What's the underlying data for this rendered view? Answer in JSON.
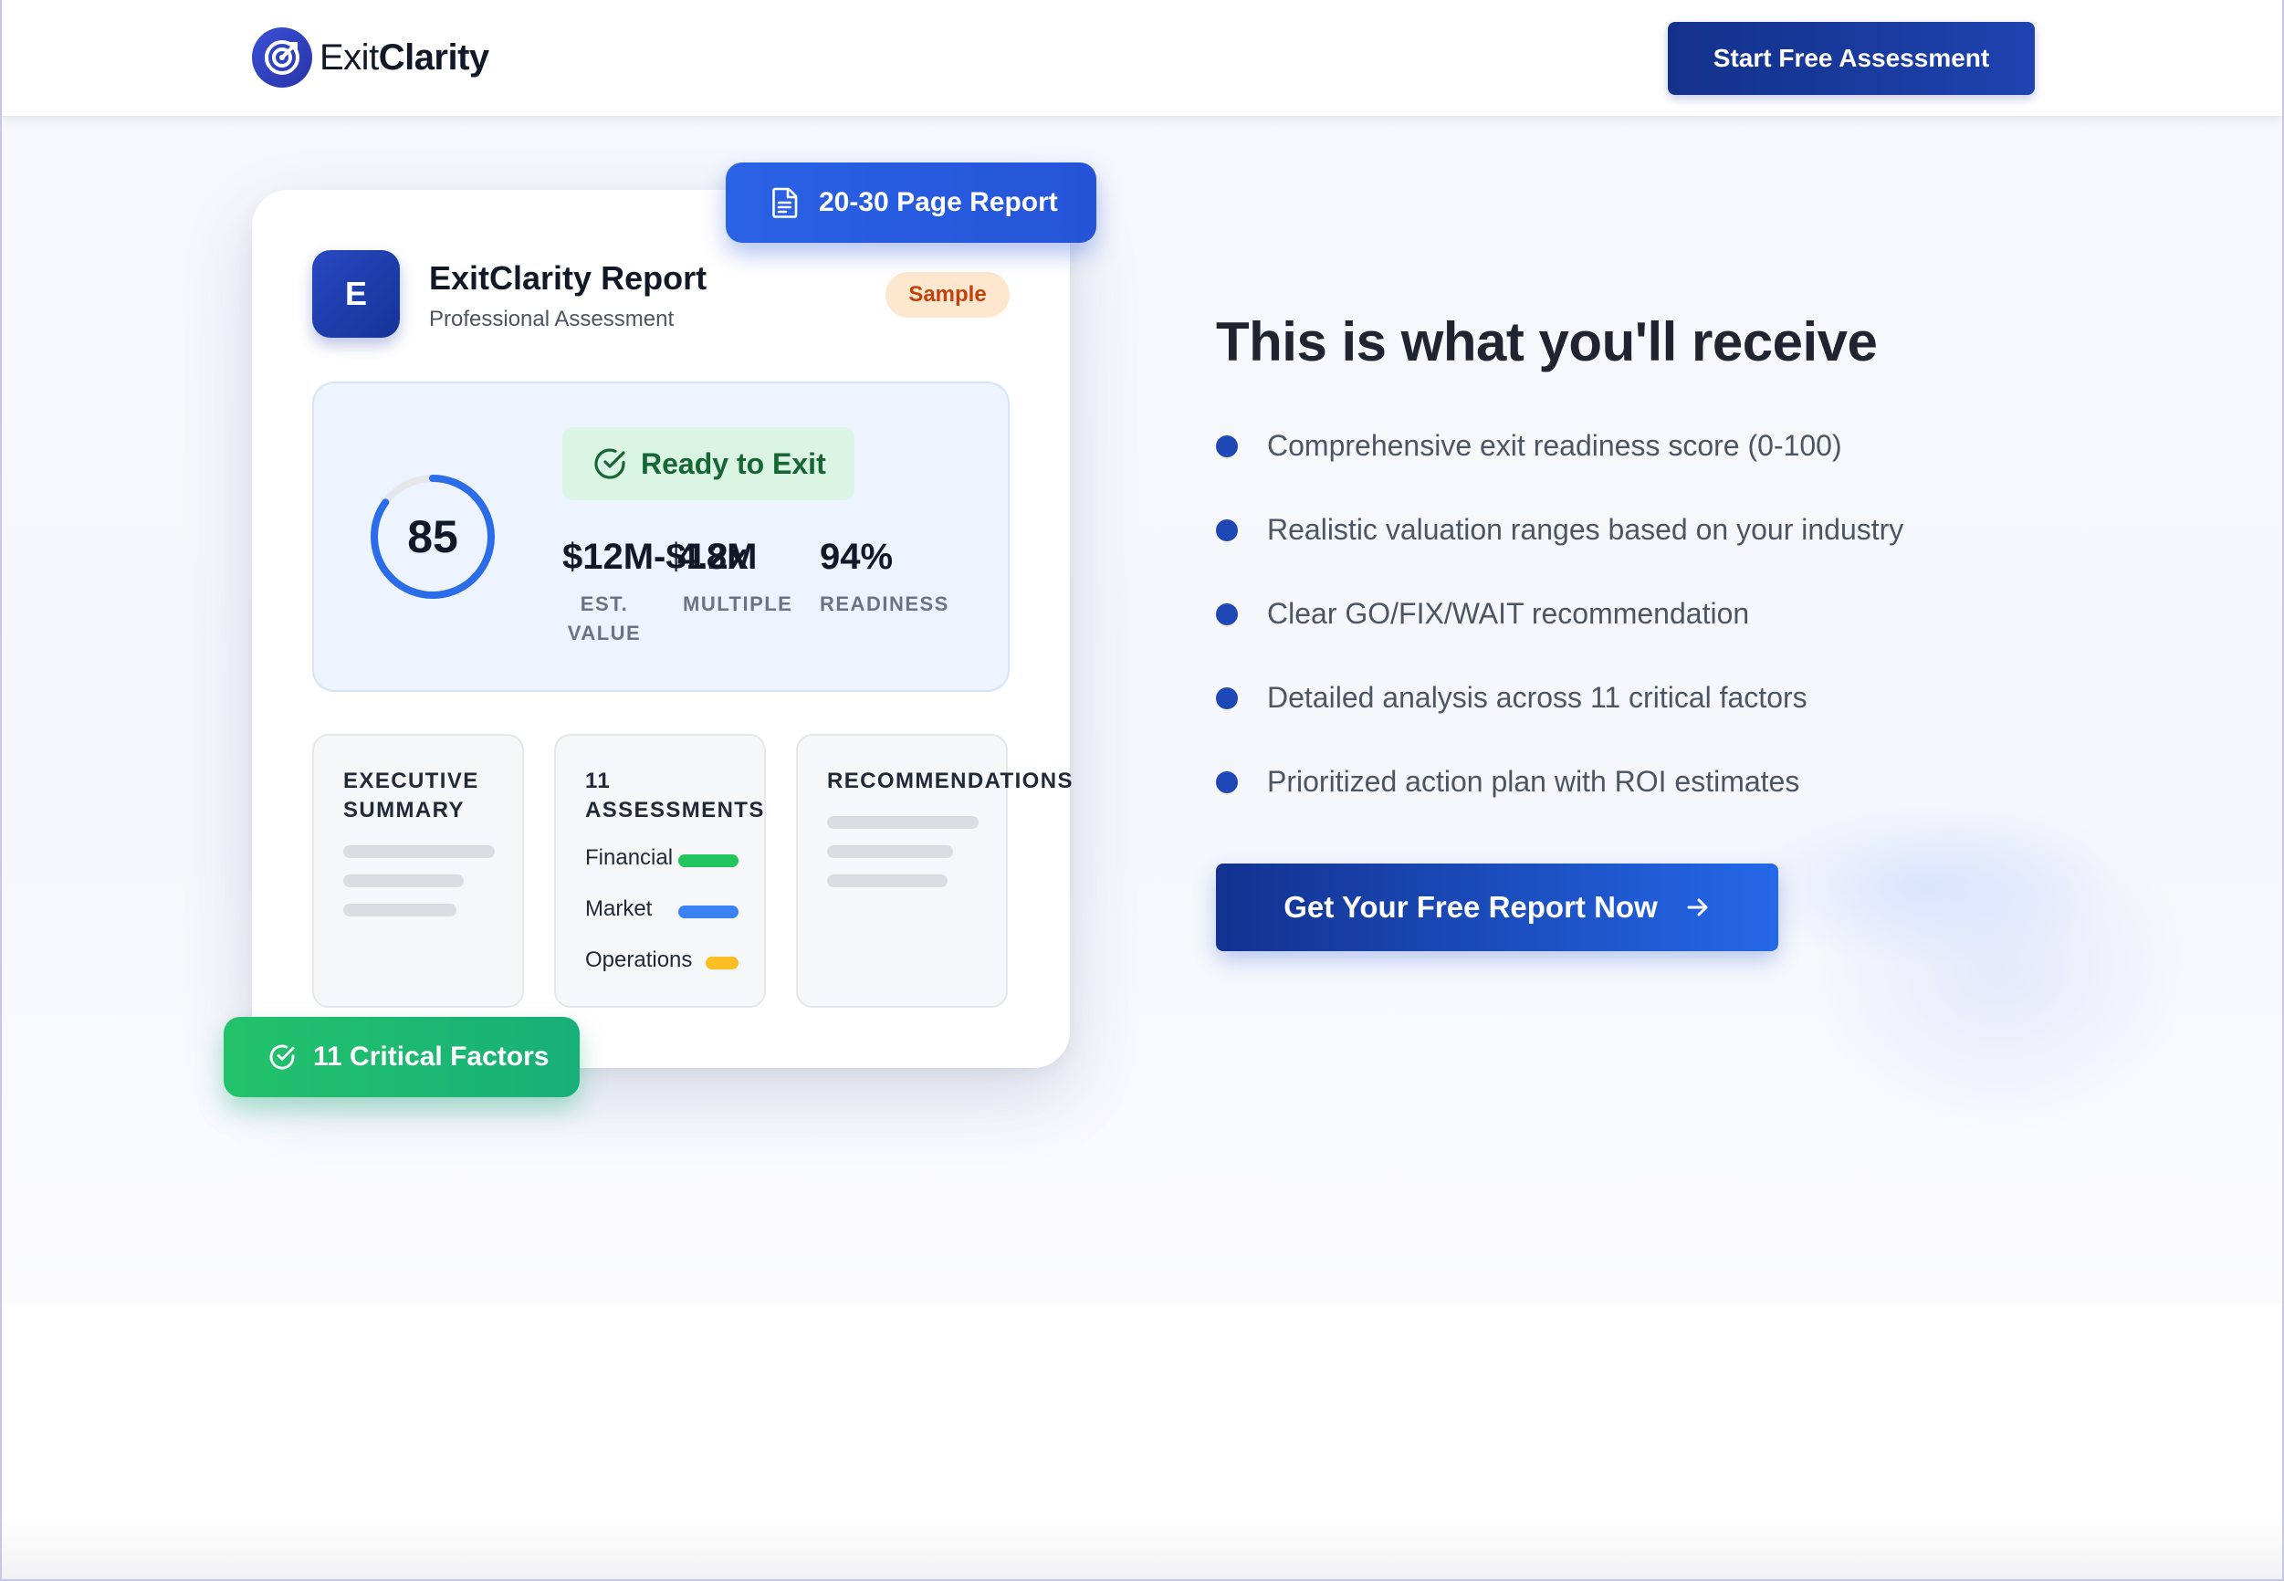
{
  "header": {
    "logo_prefix": "Exit",
    "logo_suffix": "Clarity",
    "cta_label": "Start Free Assessment"
  },
  "report_card": {
    "avatar_letter": "E",
    "title": "ExitClarity Report",
    "subtitle": "Professional Assessment",
    "badge": "Sample",
    "score": "85",
    "score_fraction": 0.85,
    "status": "Ready to Exit",
    "stats": [
      {
        "value": "$12M-$18M",
        "label_lines": [
          "EST.",
          "VALUE"
        ]
      },
      {
        "value": "4.2x",
        "label_lines": [
          "MULTIPLE"
        ]
      },
      {
        "value": "94%",
        "label_lines": [
          "READINESS"
        ]
      }
    ],
    "sections": [
      {
        "title_lines": [
          "EXECUTIVE",
          "SUMMARY"
        ]
      },
      {
        "title_lines": [
          "11",
          "ASSESSMENTS"
        ],
        "bars": [
          {
            "label": "Financial",
            "color": "#22c55e"
          },
          {
            "label": "Market",
            "color": "#3b82f6"
          },
          {
            "label": "Operations",
            "color": "#fbbf24"
          }
        ]
      },
      {
        "title_lines": [
          "RECOMMENDATIONS"
        ]
      }
    ]
  },
  "floating_badges": {
    "report_pages": "20-30 Page Report",
    "critical_factors": "11 Critical Factors"
  },
  "benefits": {
    "heading": "This is what you'll receive",
    "items": [
      "Comprehensive exit readiness score (0-100)",
      "Realistic valuation ranges based on your industry",
      "Clear GO/FIX/WAIT recommendation",
      "Detailed analysis across 11 critical factors",
      "Prioritized action plan with ROI estimates"
    ],
    "cta_label": "Get Your Free Report Now"
  },
  "colors": {
    "brand_navy": "#12318f",
    "brand_blue": "#2468e8",
    "success_green": "#22c26a",
    "sample_badge_text": "#c2410c"
  }
}
